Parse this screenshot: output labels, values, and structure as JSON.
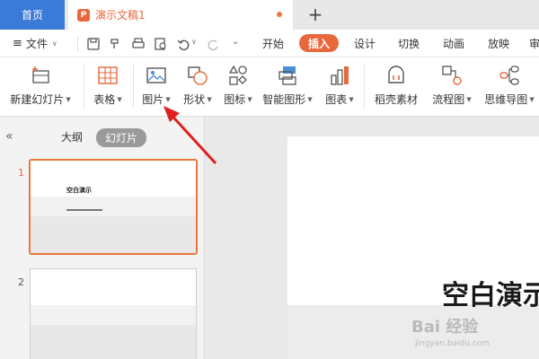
{
  "titlebar": {
    "home_tab": "首页",
    "doc_tab_label": "演示文稿1",
    "doc_icon_letter": "P",
    "new_tab_symbol": "+"
  },
  "menubar": {
    "file_menu": "文件",
    "tabs": [
      {
        "label": "开始"
      },
      {
        "label": "插入"
      },
      {
        "label": "设计"
      },
      {
        "label": "切换"
      },
      {
        "label": "动画"
      },
      {
        "label": "放映"
      }
    ],
    "active_tab": "插入"
  },
  "ribbon": {
    "items": [
      {
        "label": "新建幻灯片",
        "icon": "new-slide-icon",
        "dropdown": true
      },
      {
        "label": "表格",
        "icon": "table-icon",
        "dropdown": true
      },
      {
        "label": "图片",
        "icon": "picture-icon",
        "dropdown": true
      },
      {
        "label": "形状",
        "icon": "shape-icon",
        "dropdown": true
      },
      {
        "label": "图标",
        "icon": "icons-icon",
        "dropdown": true
      },
      {
        "label": "智能图形",
        "icon": "smartart-icon",
        "dropdown": true
      },
      {
        "label": "图表",
        "icon": "chart-icon",
        "dropdown": true
      },
      {
        "label": "稻壳素材",
        "icon": "docer-material-icon",
        "dropdown": false
      },
      {
        "label": "流程图",
        "icon": "flowchart-icon",
        "dropdown": true
      },
      {
        "label": "思维导图",
        "icon": "mindmap-icon",
        "dropdown": true
      }
    ]
  },
  "left_panel": {
    "view_outline": "大纲",
    "view_slides": "幻灯片",
    "slides": [
      {
        "number": "1",
        "title": "空白演示",
        "selected": true
      },
      {
        "number": "2",
        "title": "",
        "selected": false
      }
    ]
  },
  "canvas": {
    "slide_title": "空白演示"
  },
  "watermark": {
    "text": "Bai 经验",
    "sub": "jingyan.baidu.com"
  },
  "colors": {
    "accent": "#e8683d",
    "home_tab": "#3c7ad8",
    "annotation_arrow": "#e02020"
  }
}
